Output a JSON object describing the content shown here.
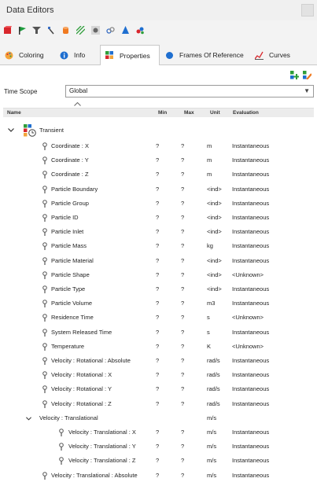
{
  "window": {
    "title": "Data Editors"
  },
  "toolbar": {
    "icons": [
      "red-cube-icon",
      "green-flag-icon",
      "filter-icon",
      "probe-icon",
      "cylinder-icon",
      "hatch-icon",
      "point-icon",
      "link-icon",
      "cone-icon",
      "multi-dot-icon"
    ]
  },
  "tabs": [
    {
      "label": "Coloring",
      "icon": "palette-icon"
    },
    {
      "label": "Info",
      "icon": "info-icon"
    },
    {
      "label": "Properties",
      "icon": "properties-icon",
      "active": true
    },
    {
      "label": "Frames Of Reference",
      "icon": "blue-dot-icon"
    },
    {
      "label": "Curves",
      "icon": "curves-icon"
    }
  ],
  "time_scope": {
    "label": "Time Scope",
    "value": "Global"
  },
  "columns": {
    "name": "Name",
    "min": "Min",
    "max": "Max",
    "unit": "Unit",
    "evaluation": "Evaluation"
  },
  "group": {
    "label": "Transient"
  },
  "rows": [
    {
      "name": "Coordinate : X",
      "min": "?",
      "max": "?",
      "unit": "m",
      "evaluation": "Instantaneous"
    },
    {
      "name": "Coordinate : Y",
      "min": "?",
      "max": "?",
      "unit": "m",
      "evaluation": "Instantaneous"
    },
    {
      "name": "Coordinate : Z",
      "min": "?",
      "max": "?",
      "unit": "m",
      "evaluation": "Instantaneous"
    },
    {
      "name": "Particle Boundary",
      "min": "?",
      "max": "?",
      "unit": "<ind>",
      "evaluation": "Instantaneous"
    },
    {
      "name": "Particle Group",
      "min": "?",
      "max": "?",
      "unit": "<ind>",
      "evaluation": "Instantaneous"
    },
    {
      "name": "Particle ID",
      "min": "?",
      "max": "?",
      "unit": "<ind>",
      "evaluation": "Instantaneous"
    },
    {
      "name": "Particle Inlet",
      "min": "?",
      "max": "?",
      "unit": "<ind>",
      "evaluation": "Instantaneous"
    },
    {
      "name": "Particle Mass",
      "min": "?",
      "max": "?",
      "unit": "kg",
      "evaluation": "Instantaneous"
    },
    {
      "name": "Particle Material",
      "min": "?",
      "max": "?",
      "unit": "<ind>",
      "evaluation": "Instantaneous"
    },
    {
      "name": "Particle Shape",
      "min": "?",
      "max": "?",
      "unit": "<ind>",
      "evaluation": "<Unknown>"
    },
    {
      "name": "Particle Type",
      "min": "?",
      "max": "?",
      "unit": "<ind>",
      "evaluation": "Instantaneous"
    },
    {
      "name": "Particle Volume",
      "min": "?",
      "max": "?",
      "unit": "m3",
      "evaluation": "Instantaneous"
    },
    {
      "name": "Residence Time",
      "min": "?",
      "max": "?",
      "unit": "s",
      "evaluation": "<Unknown>"
    },
    {
      "name": "System Released Time",
      "min": "?",
      "max": "?",
      "unit": "s",
      "evaluation": "Instantaneous"
    },
    {
      "name": "Temperature",
      "min": "?",
      "max": "?",
      "unit": "K",
      "evaluation": "<Unknown>"
    },
    {
      "name": "Velocity : Rotational : Absolute",
      "min": "?",
      "max": "?",
      "unit": "rad/s",
      "evaluation": "Instantaneous"
    },
    {
      "name": "Velocity : Rotational : X",
      "min": "?",
      "max": "?",
      "unit": "rad/s",
      "evaluation": "Instantaneous"
    },
    {
      "name": "Velocity : Rotational : Y",
      "min": "?",
      "max": "?",
      "unit": "rad/s",
      "evaluation": "Instantaneous"
    },
    {
      "name": "Velocity : Rotational : Z",
      "min": "?",
      "max": "?",
      "unit": "rad/s",
      "evaluation": "Instantaneous"
    },
    {
      "name": "Velocity : Translational",
      "min": "",
      "max": "",
      "unit": "m/s",
      "evaluation": "",
      "group": true
    },
    {
      "name": "Velocity : Translational : X",
      "min": "?",
      "max": "?",
      "unit": "m/s",
      "evaluation": "Instantaneous",
      "child": true
    },
    {
      "name": "Velocity : Translational : Y",
      "min": "?",
      "max": "?",
      "unit": "m/s",
      "evaluation": "Instantaneous",
      "child": true
    },
    {
      "name": "Velocity : Translational : Z",
      "min": "?",
      "max": "?",
      "unit": "m/s",
      "evaluation": "Instantaneous",
      "child": true
    },
    {
      "name": "Velocity : Translational : Absolute",
      "min": "?",
      "max": "?",
      "unit": "m/s",
      "evaluation": "Instantaneous"
    }
  ]
}
